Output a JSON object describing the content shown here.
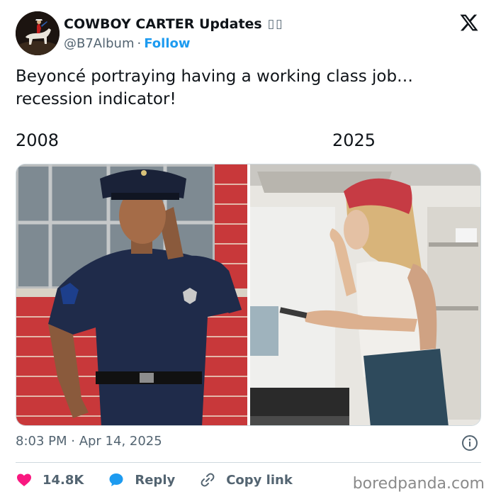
{
  "author": {
    "display_name": "COWBOY CARTER Updates",
    "name_glyphs": "▯▯",
    "handle": "@B7Album",
    "separator": "·",
    "follow_label": "Follow"
  },
  "tweet": {
    "line1": "Beyoncé portraying having a working class job…",
    "line2": "recession indicator!",
    "label_left": "2008",
    "label_right": "2025"
  },
  "meta": {
    "timestamp": "8:03 PM · Apr 14, 2025"
  },
  "actions": {
    "likes": "14.8K",
    "reply_label": "Reply",
    "copy_link_label": "Copy link"
  },
  "watermark": "boredpanda.com",
  "colors": {
    "accent": "#1d9bf0",
    "heart": "#f91880",
    "reply": "#1d9bf0",
    "text": "#0f1419",
    "muted": "#536471"
  },
  "icons": {
    "platform": "x-logo-icon",
    "info": "info-icon",
    "like": "heart-icon",
    "reply": "speech-bubble-icon",
    "copy": "link-icon"
  }
}
